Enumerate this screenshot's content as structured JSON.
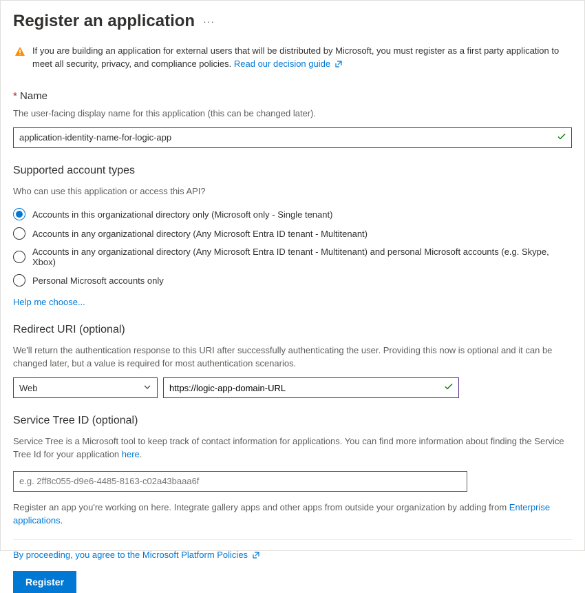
{
  "header": {
    "title": "Register an application"
  },
  "info_bar": {
    "text": "If you are building an application for external users that will be distributed by Microsoft, you must register as a first party application to meet all security, privacy, and compliance policies.",
    "link_text": "Read our decision guide"
  },
  "name_section": {
    "label": "Name",
    "helper": "The user-facing display name for this application (this can be changed later).",
    "value": "application-identity-name-for-logic-app"
  },
  "account_types": {
    "heading": "Supported account types",
    "question": "Who can use this application or access this API?",
    "options": [
      "Accounts in this organizational directory only (Microsoft only - Single tenant)",
      "Accounts in any organizational directory (Any Microsoft Entra ID tenant - Multitenant)",
      "Accounts in any organizational directory (Any Microsoft Entra ID tenant - Multitenant) and personal Microsoft accounts (e.g. Skype, Xbox)",
      "Personal Microsoft accounts only"
    ],
    "selected_index": 0,
    "help_link": "Help me choose..."
  },
  "redirect": {
    "heading": "Redirect URI (optional)",
    "helper": "We'll return the authentication response to this URI after successfully authenticating the user. Providing this now is optional and it can be changed later, but a value is required for most authentication scenarios.",
    "platform_value": "Web",
    "uri_value": "https://logic-app-domain-URL"
  },
  "service_tree": {
    "heading": "Service Tree ID (optional)",
    "helper_prefix": "Service Tree is a Microsoft tool to keep track of contact information for applications. You can find more information about finding the Service Tree Id for your application ",
    "helper_link": "here",
    "placeholder": "e.g. 2ff8c055-d9e6-4485-8163-c02a43baaa6f"
  },
  "footnote": {
    "text_prefix": "Register an app you're working on here. Integrate gallery apps and other apps from outside your organization by adding from ",
    "link": "Enterprise applications"
  },
  "proceed": {
    "text": "By proceeding, you agree to the Microsoft Platform Policies"
  },
  "register_button": "Register"
}
